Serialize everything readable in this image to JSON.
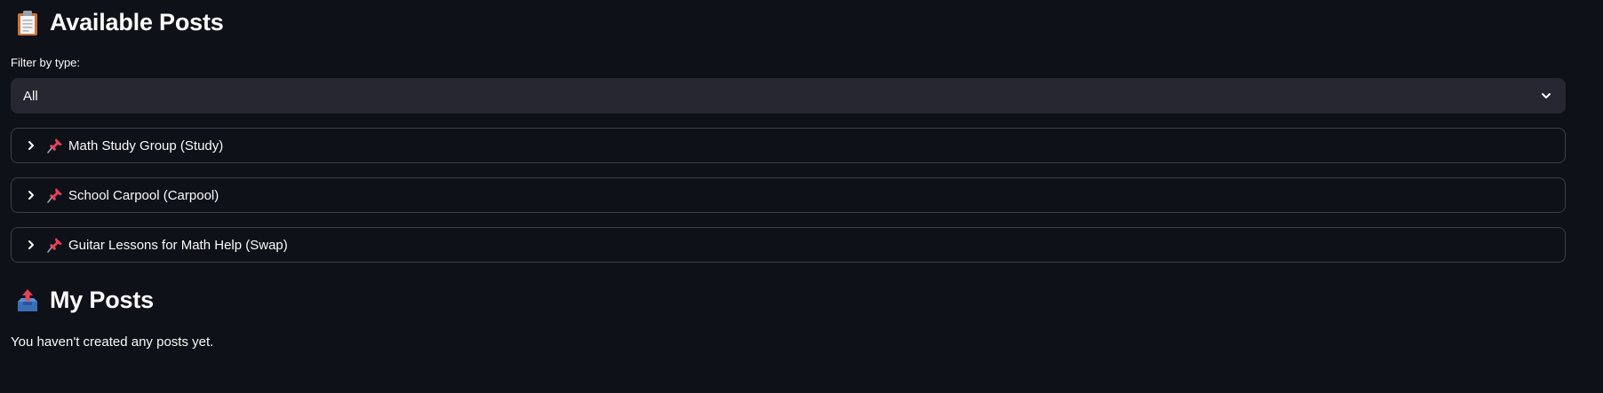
{
  "available": {
    "title": "Available Posts",
    "icon": "clipboard-icon",
    "filter_label": "Filter by type:",
    "filter_value": "All",
    "posts": [
      {
        "label": "Math Study Group (Study)",
        "icon": "pushpin-icon"
      },
      {
        "label": "School Carpool (Carpool)",
        "icon": "pushpin-icon"
      },
      {
        "label": "Guitar Lessons for Math Help (Swap)",
        "icon": "pushpin-icon"
      }
    ]
  },
  "mine": {
    "title": "My Posts",
    "icon": "outbox-tray-icon",
    "empty_text": "You haven't created any posts yet."
  },
  "colors": {
    "background": "#0e1117",
    "select_bg": "#262730",
    "border": "#3b3f4a",
    "pin": "#e8405a"
  }
}
